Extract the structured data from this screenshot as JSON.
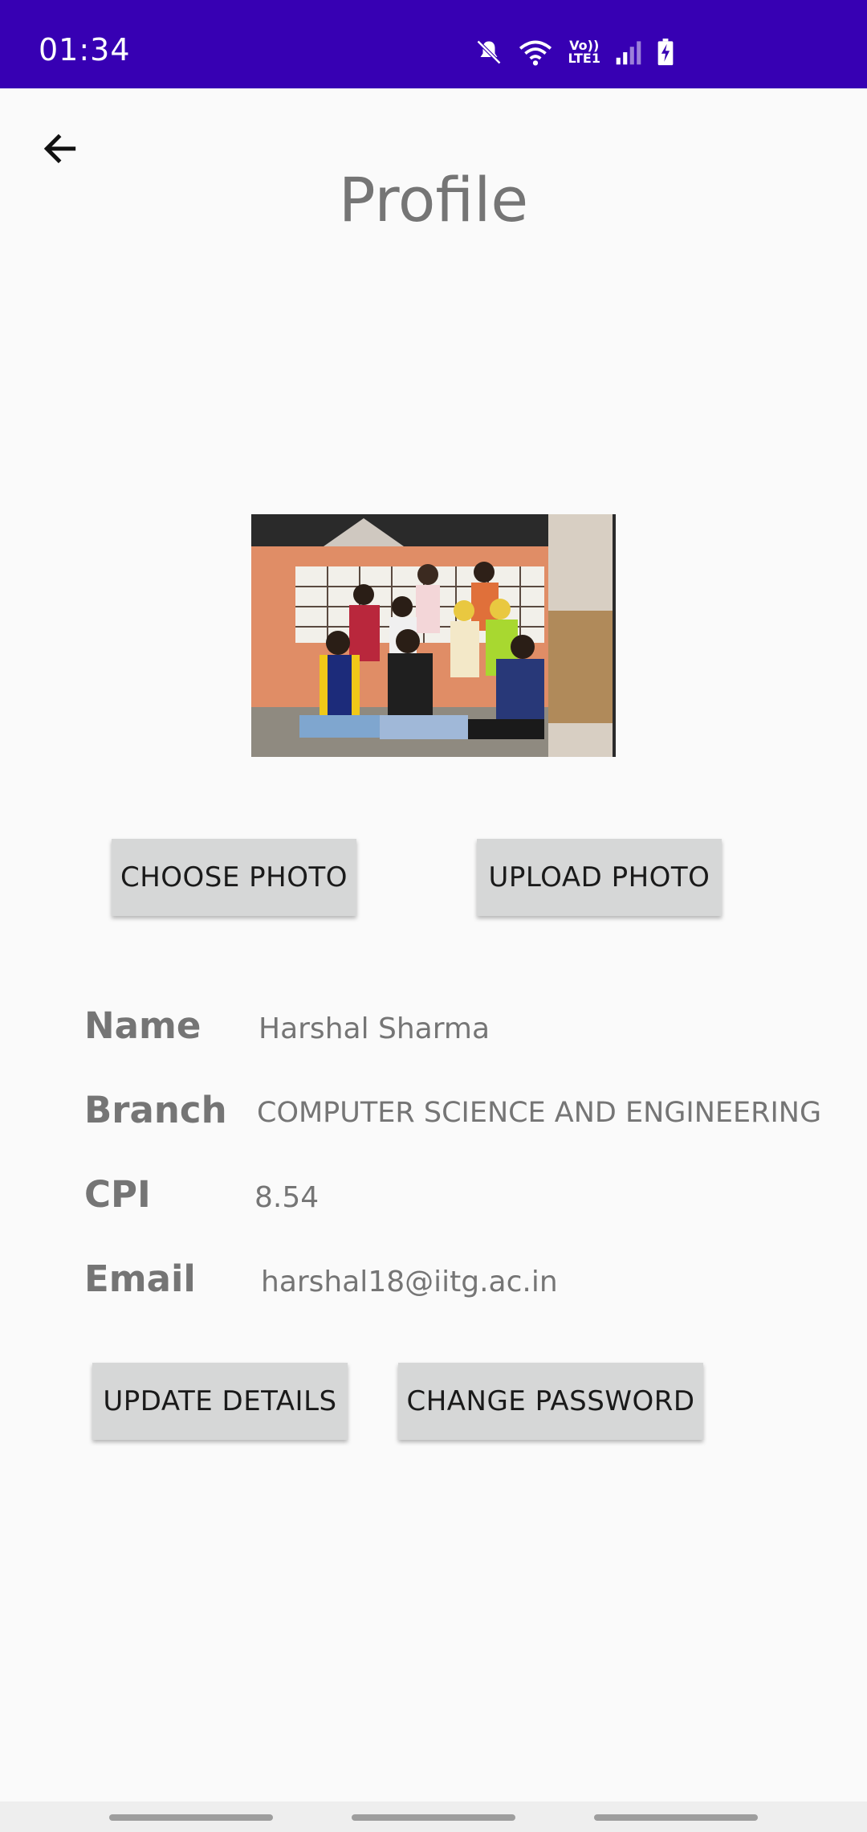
{
  "status_bar": {
    "time": "01:34",
    "network_label_top": "Vo))",
    "network_label_bottom": "LTE1",
    "icons": [
      "mute-icon",
      "wifi-icon",
      "lte-icon",
      "signal-icon",
      "battery-charging-icon"
    ]
  },
  "header": {
    "back_icon": "arrow-left-icon",
    "title": "Profile"
  },
  "photo": {
    "description_icon": "profile-photo"
  },
  "photo_actions": {
    "choose_label": "CHOOSE PHOTO",
    "upload_label": "UPLOAD PHOTO"
  },
  "details": {
    "name_label": "Name",
    "name_value": "Harshal Sharma",
    "branch_label": "Branch",
    "branch_value": "COMPUTER SCIENCE AND ENGINEERING",
    "cpi_label": "CPI",
    "cpi_value": "8.54",
    "email_label": "Email",
    "email_value": "harshal18@iitg.ac.in"
  },
  "account_actions": {
    "update_label": "UPDATE DETAILS",
    "password_label": "CHANGE PASSWORD"
  },
  "colors": {
    "status_bar": "#3700b3",
    "background": "#fafafa",
    "button": "#d6d7d7",
    "text_grey": "#757575"
  }
}
